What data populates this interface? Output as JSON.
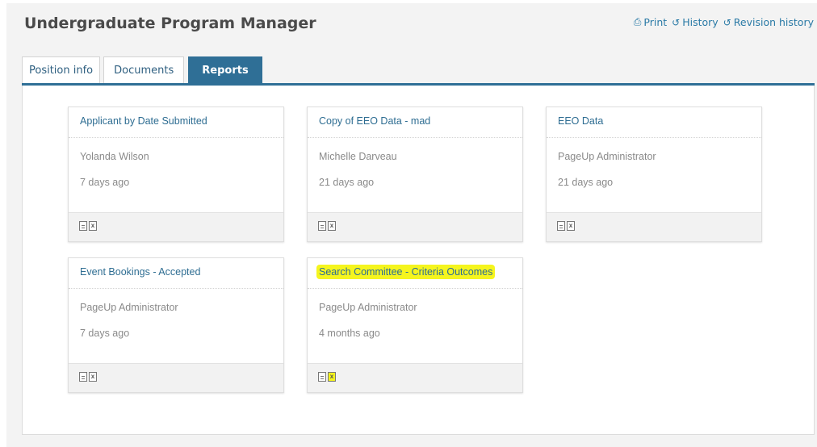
{
  "header": {
    "title": "Undergraduate Program Manager",
    "actions": [
      {
        "label": "Print",
        "icon": "print-icon"
      },
      {
        "label": "History",
        "icon": "history-icon"
      },
      {
        "label": "Revision history",
        "icon": "history-icon"
      }
    ]
  },
  "tabs": [
    {
      "label": "Position info",
      "active": false
    },
    {
      "label": "Documents",
      "active": false
    },
    {
      "label": "Reports",
      "active": true
    }
  ],
  "reports": [
    {
      "title": "Applicant by Date Submitted",
      "owner": "Yolanda Wilson",
      "date": "7 days ago",
      "highlighted": false
    },
    {
      "title": "Copy of EEO Data - mad",
      "owner": "Michelle Darveau",
      "date": "21 days ago",
      "highlighted": false
    },
    {
      "title": "EEO Data",
      "owner": "PageUp Administrator",
      "date": "21 days ago",
      "highlighted": false
    },
    {
      "title": "Event Bookings - Accepted",
      "owner": "PageUp Administrator",
      "date": "7 days ago",
      "highlighted": false
    },
    {
      "title": "Search Committee - Criteria Outcomes",
      "owner": "PageUp Administrator",
      "date": "4 months ago",
      "highlighted": true
    }
  ],
  "colors": {
    "accent": "#2f6f96",
    "link": "#2e6d92",
    "highlight": "#f5f51e"
  }
}
